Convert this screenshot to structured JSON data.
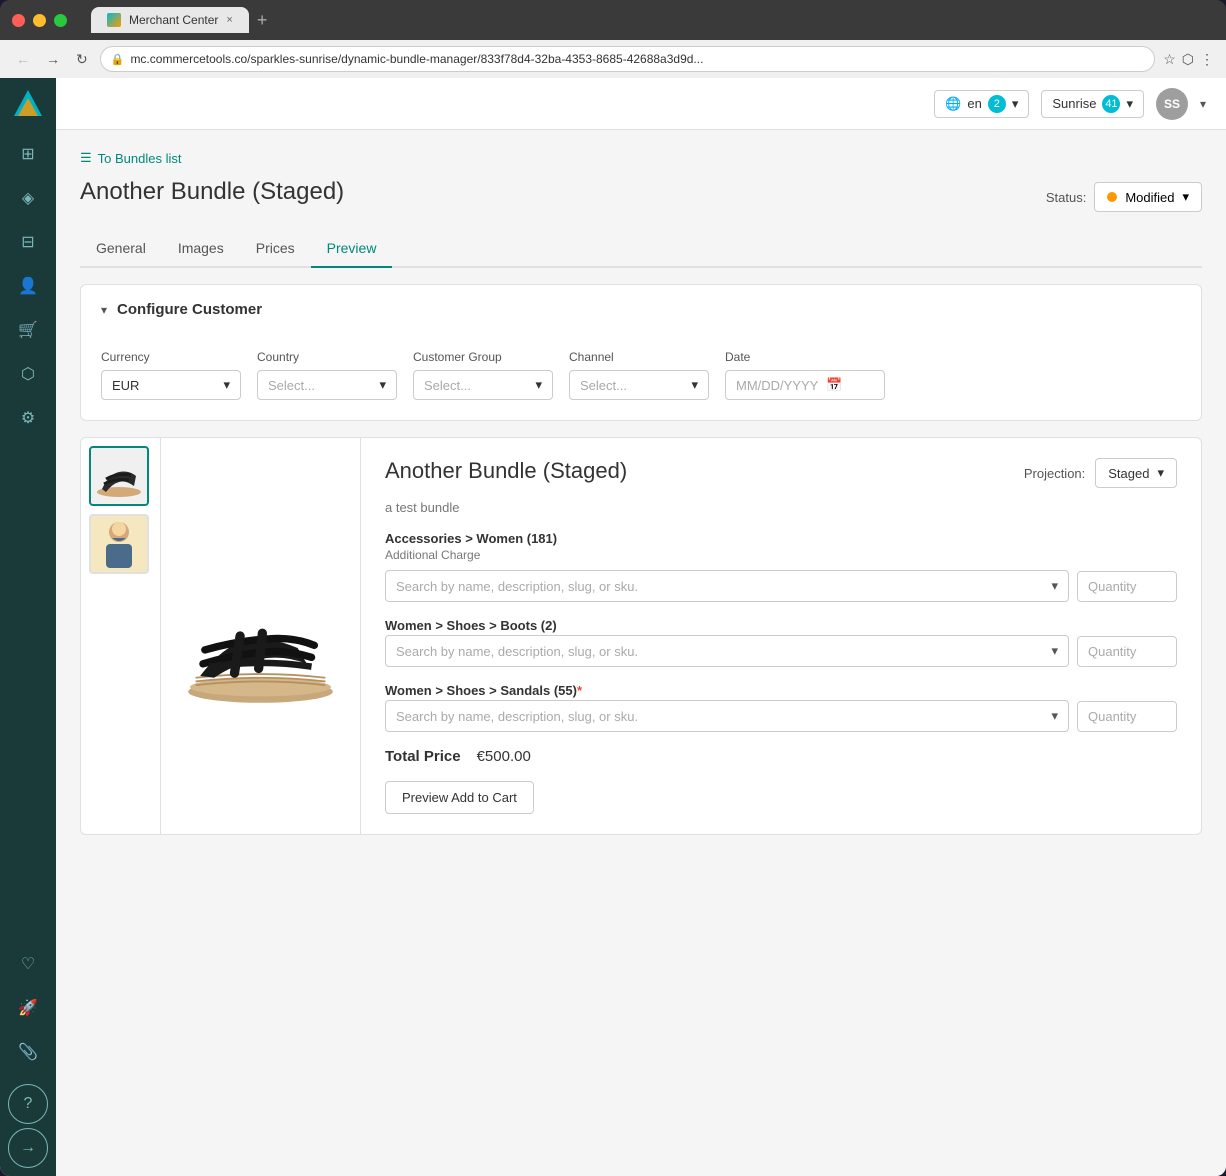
{
  "browser": {
    "tab_title": "Merchant Center",
    "url": "mc.commercetools.co/sparkles-sunrise/dynamic-bundle-manager/833f78d4-32ba-4353-8685-42688a3d9d...",
    "close_btn": "×",
    "new_tab_btn": "+"
  },
  "app_header": {
    "lang": "en",
    "lang_count": "2",
    "project": "Sunrise",
    "project_count": "41",
    "user_initials": "SS"
  },
  "breadcrumb": {
    "text": "To Bundles list"
  },
  "page": {
    "title": "Another Bundle (Staged)",
    "tabs": [
      "General",
      "Images",
      "Prices",
      "Preview"
    ],
    "active_tab": "Preview",
    "status_label": "Status:",
    "status_value": "Modified"
  },
  "configure_customer": {
    "title": "Configure Customer",
    "currency_label": "Currency",
    "currency_value": "EUR",
    "country_label": "Country",
    "country_placeholder": "Select...",
    "customer_group_label": "Customer Group",
    "customer_group_placeholder": "Select...",
    "channel_label": "Channel",
    "channel_placeholder": "Select...",
    "date_label": "Date",
    "date_placeholder": "MM/DD/YYYY"
  },
  "preview": {
    "product_title": "Another Bundle (Staged)",
    "product_subtitle": "a test bundle",
    "projection_label": "Projection:",
    "projection_value": "Staged",
    "sections": [
      {
        "title": "Accessories > Women (181)",
        "subtitle": "Additional Charge",
        "search_placeholder": "Search by name, description, slug, or sku.",
        "qty_placeholder": "Quantity",
        "required": false
      },
      {
        "title": "Women > Shoes > Boots (2)",
        "subtitle": "",
        "search_placeholder": "Search by name, description, slug, or sku.",
        "qty_placeholder": "Quantity",
        "required": false
      },
      {
        "title": "Women > Shoes > Sandals (55)",
        "subtitle": "",
        "search_placeholder": "Search by name, description, slug, or sku.",
        "qty_placeholder": "Quantity",
        "required": true
      }
    ],
    "total_price_label": "Total Price",
    "total_price_value": "€500.00",
    "add_to_cart_btn": "Preview Add to Cart"
  },
  "sidebar": {
    "items": [
      {
        "name": "dashboard",
        "icon": "⊞"
      },
      {
        "name": "products",
        "icon": "◈"
      },
      {
        "name": "catalog",
        "icon": "⊟"
      },
      {
        "name": "customers",
        "icon": "👤"
      },
      {
        "name": "cart",
        "icon": "🛒"
      },
      {
        "name": "tags",
        "icon": "⬡"
      },
      {
        "name": "settings",
        "icon": "⚙"
      },
      {
        "name": "favorites",
        "icon": "♡"
      },
      {
        "name": "rocket",
        "icon": "🚀"
      },
      {
        "name": "clip",
        "icon": "📎"
      }
    ]
  }
}
